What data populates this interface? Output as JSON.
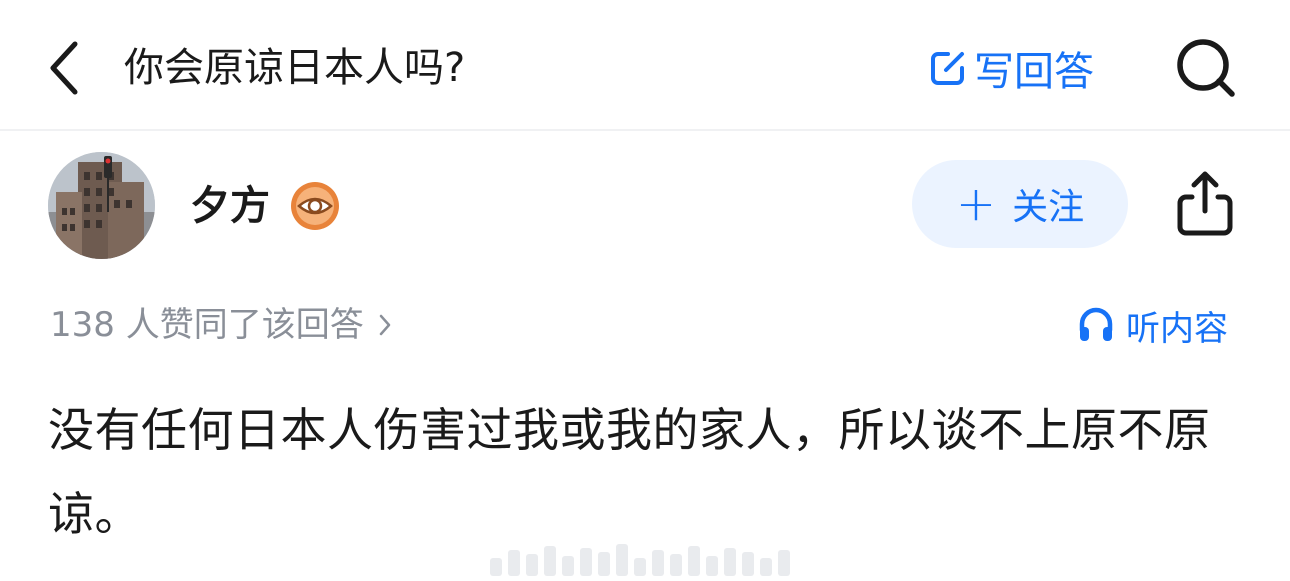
{
  "nav": {
    "title": "你会原谅日本人吗?",
    "write_answer_label": "写回答",
    "back_icon": "chevron-left-icon",
    "search_icon": "search-icon",
    "edit_icon": "edit-icon"
  },
  "author": {
    "name": "夕方",
    "badge_icon": "eye-icon",
    "follow_label": "关注",
    "follow_plus": "+",
    "share_icon": "share-icon"
  },
  "meta": {
    "likes_text": "138 人赞同了该回答",
    "likes_chevron": "›",
    "listen_label": "听内容",
    "listen_icon": "headphones-icon"
  },
  "answer": {
    "text": "没有任何日本人伤害过我或我的家人，所以谈不上原不原谅。"
  },
  "colors": {
    "accent": "#1772f6",
    "follow_bg": "#ebf3ff",
    "muted_text": "#8a8f98",
    "badge_orange": "#e8833a"
  }
}
